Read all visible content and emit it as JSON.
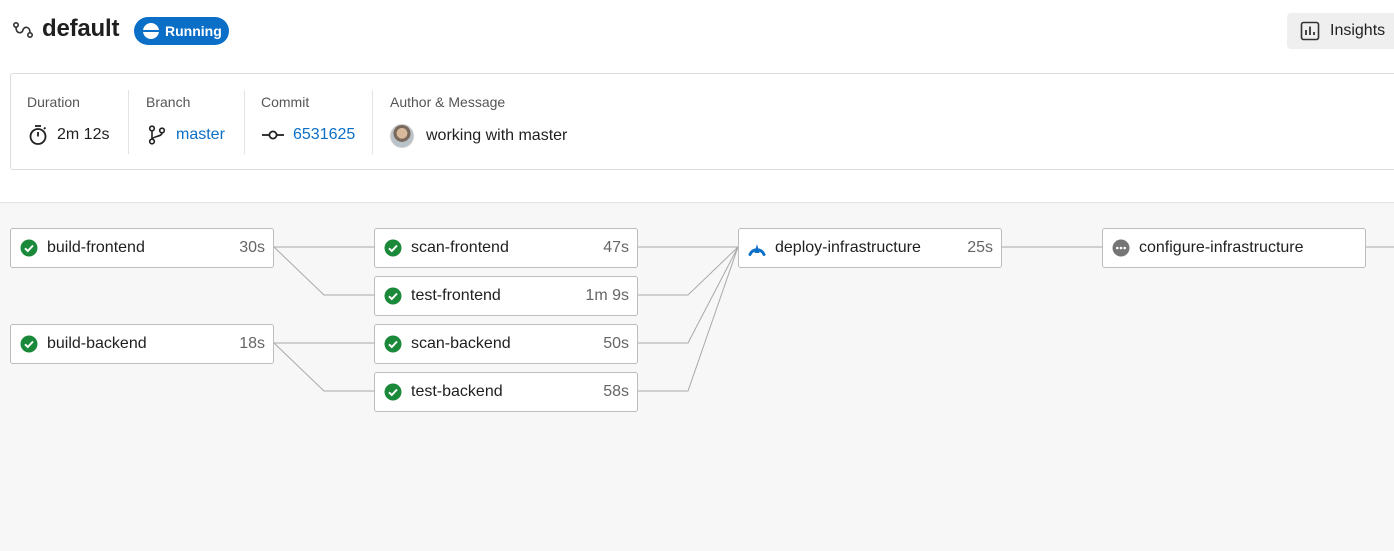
{
  "header": {
    "title": "default",
    "status": "Running",
    "insights_label": "Insights"
  },
  "info": {
    "duration": {
      "label": "Duration",
      "value": "2m 12s"
    },
    "branch": {
      "label": "Branch",
      "value": "master"
    },
    "commit": {
      "label": "Commit",
      "value": "6531625"
    },
    "author": {
      "label": "Author & Message",
      "message": "working with master"
    }
  },
  "jobs": [
    {
      "name": "build-frontend",
      "duration": "30s",
      "status": "success"
    },
    {
      "name": "build-backend",
      "duration": "18s",
      "status": "success"
    },
    {
      "name": "scan-frontend",
      "duration": "47s",
      "status": "success"
    },
    {
      "name": "test-frontend",
      "duration": "1m 9s",
      "status": "success"
    },
    {
      "name": "scan-backend",
      "duration": "50s",
      "status": "success"
    },
    {
      "name": "test-backend",
      "duration": "58s",
      "status": "success"
    },
    {
      "name": "deploy-infrastructure",
      "duration": "25s",
      "status": "running"
    },
    {
      "name": "configure-infrastructure",
      "duration": "",
      "status": "pending"
    }
  ],
  "colors": {
    "accent": "#0b6fc7",
    "success": "#1a8a3a",
    "pending": "#757575"
  },
  "icons": {
    "workflow": "workflow-icon",
    "timer": "stopwatch-icon",
    "branch": "git-branch-icon",
    "commit": "git-commit-icon",
    "insights": "bar-chart-icon"
  }
}
